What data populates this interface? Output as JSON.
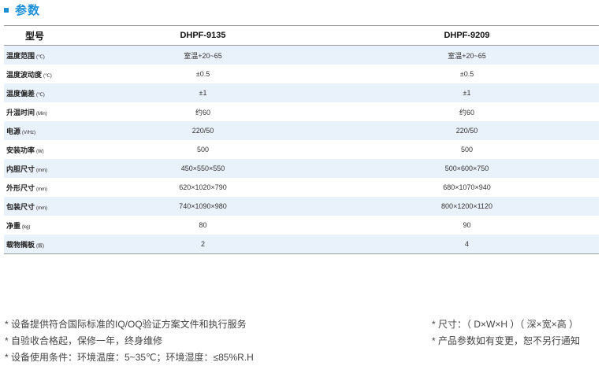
{
  "section": {
    "title": "参数"
  },
  "table": {
    "header": {
      "label": "型号",
      "models": [
        "DHPF-9135",
        "DHPF-9209"
      ]
    },
    "rows": [
      {
        "name": "温度范围",
        "unit": "(℃)",
        "values": [
          "室温+20~65",
          "室温+20~65"
        ]
      },
      {
        "name": "温度波动度",
        "unit": "(℃)",
        "values": [
          "±0.5",
          "±0.5"
        ]
      },
      {
        "name": "温度偏差",
        "unit": "(℃)",
        "values": [
          "±1",
          "±1"
        ]
      },
      {
        "name": "升温时间",
        "unit": "(Min)",
        "values": [
          "约60",
          "约60"
        ]
      },
      {
        "name": "电源",
        "unit": "(V/Hz)",
        "values": [
          "220/50",
          "220/50"
        ]
      },
      {
        "name": "安装功率",
        "unit": "(W)",
        "values": [
          "500",
          "500"
        ]
      },
      {
        "name": "内胆尺寸",
        "unit": "(mm)",
        "values": [
          "450×550×550",
          "500×600×750"
        ]
      },
      {
        "name": "外形尺寸",
        "unit": "(mm)",
        "values": [
          "620×1020×790",
          "680×1070×940"
        ]
      },
      {
        "name": "包装尺寸",
        "unit": "(mm)",
        "values": [
          "740×1090×980",
          "800×1200×1120"
        ]
      },
      {
        "name": "净重",
        "unit": "(kg)",
        "values": [
          "80",
          "90"
        ]
      },
      {
        "name": "载物搁板",
        "unit": "(层)",
        "values": [
          "2",
          "4"
        ]
      }
    ]
  },
  "notes_left": [
    "* 设备提供符合国际标准的IQ/OQ验证方案文件和执行服务",
    "* 自验收合格起，保修一年，终身维修",
    "* 设备使用条件：环境温度：5~35℃；环境湿度：≤85%R.H"
  ],
  "notes_right": [
    "* 尺寸：（ D×W×H ）（ 深×宽×高 ）",
    "* 产品参数如有变更，恕不另行通知"
  ],
  "colors": {
    "accent": "#1a8fd8",
    "stripe": "#e9f2fa"
  }
}
